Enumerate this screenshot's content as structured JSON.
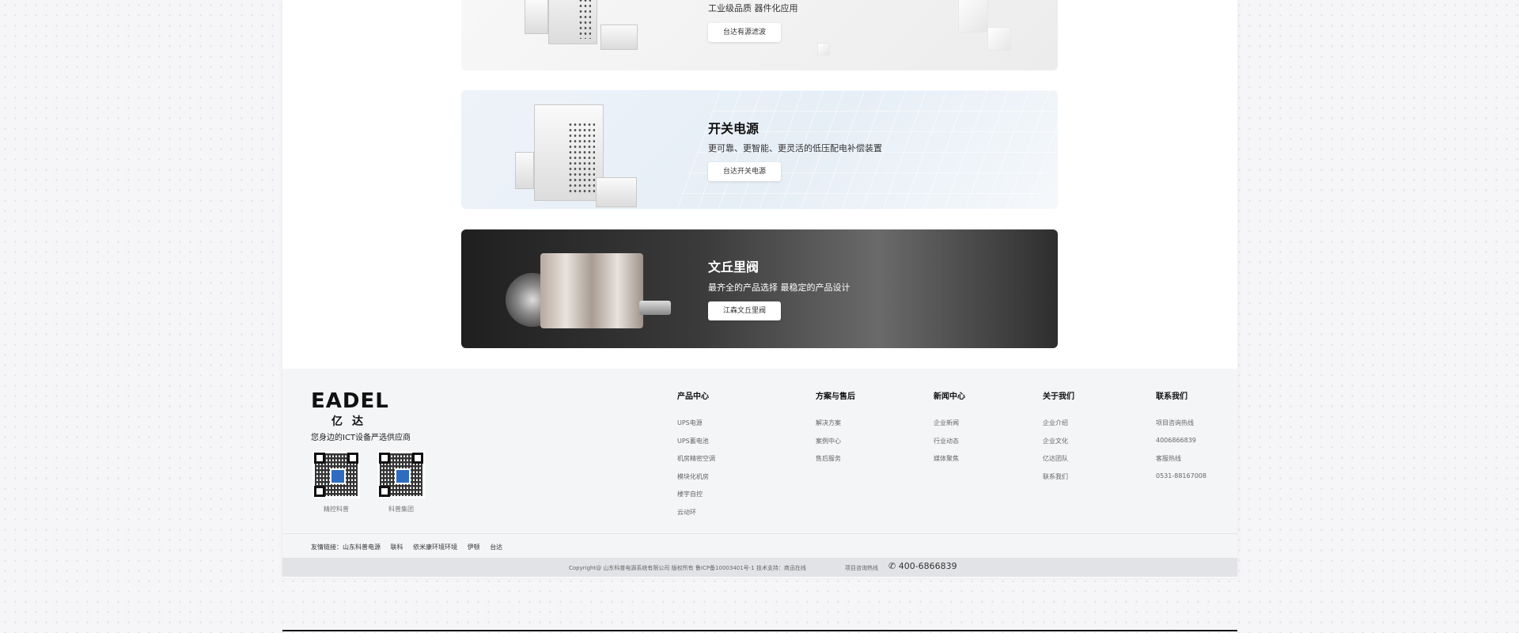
{
  "banners": [
    {
      "title": "",
      "subtitle": "工业级品质    器件化应用",
      "button": "台达有源滤波"
    },
    {
      "title": "开关电源",
      "subtitle": "更可靠、更智能、更灵活的低压配电补偿装置",
      "button": "台达开关电源"
    },
    {
      "title": "文丘里阀",
      "subtitle": "最齐全的产品选择    最稳定的产品设计",
      "button": "江森文丘里阀"
    }
  ],
  "footer": {
    "logo": "EADEL",
    "logo_cn": "亿达",
    "slogan": "您身边的ICT设备严选供应商",
    "qr": [
      {
        "caption": "精控科普",
        "icon": "qr-code-icon"
      },
      {
        "caption": "科普集团",
        "icon": "qr-code-icon"
      }
    ],
    "columns": [
      {
        "heading": "产品中心",
        "items": [
          "UPS电源",
          "UPS蓄电池",
          "机房精密空调",
          "模块化机房",
          "楼宇自控",
          "云动环"
        ]
      },
      {
        "heading": "方案与售后",
        "items": [
          "解决方案",
          "案例中心",
          "售后服务"
        ]
      },
      {
        "heading": "新闻中心",
        "items": [
          "企业新闻",
          "行业动态",
          "媒体聚焦"
        ]
      },
      {
        "heading": "关于我们",
        "items": [
          "企业介绍",
          "企业文化",
          "亿达团队",
          "联系我们"
        ]
      },
      {
        "heading": "联系我们",
        "items": [
          "项目咨询热线",
          "4006866839",
          "客服热线",
          "0531-88167008"
        ]
      }
    ],
    "friend_links_label": "友情链接：",
    "friend_links": [
      "山东科普电源",
      "联科",
      "依米康环境环境",
      "伊顿",
      "台达"
    ],
    "copyright": "Copyright@ 山东科普电源系统有限公司 版权所有 鲁ICP备10003401号-1    技术支持：商迅在线",
    "hotline_label": "项目咨询热线",
    "hotline": "400-6866839"
  }
}
